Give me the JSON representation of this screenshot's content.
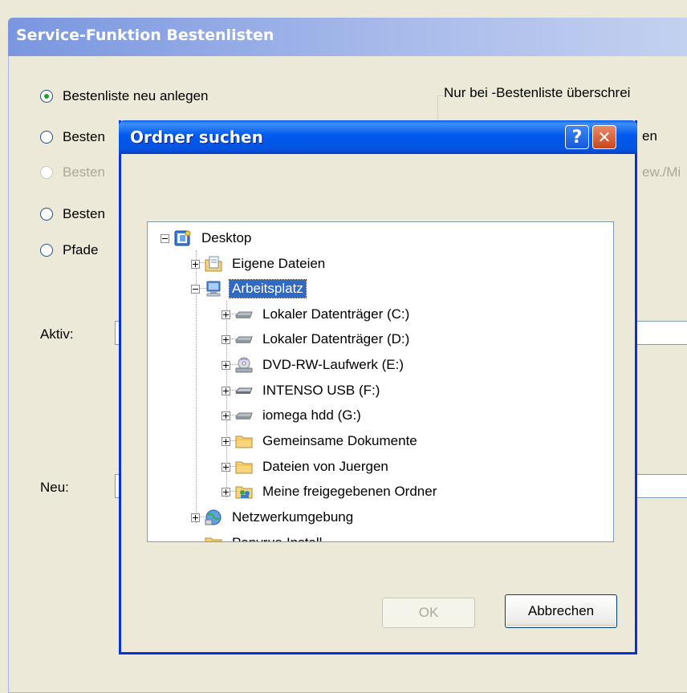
{
  "background_window": {
    "title": "Service-Funktion Bestenlisten",
    "radios": [
      {
        "label": "Bestenliste neu anlegen",
        "checked": true,
        "enabled": true
      },
      {
        "label": "Besten",
        "checked": false,
        "enabled": true
      },
      {
        "label": "Besten",
        "checked": false,
        "enabled": false
      },
      {
        "label": "Besten",
        "checked": false,
        "enabled": true
      },
      {
        "label": "Pfade",
        "checked": false,
        "enabled": true
      }
    ],
    "group_legend": "Nur bei -Bestenliste überschrei",
    "clipped_text_1": "en",
    "clipped_text_2": "ew./Mi",
    "aktiv_label": "Aktiv:",
    "neu_label": "Neu:"
  },
  "dialog": {
    "title": "Ordner suchen",
    "help_glyph": "?",
    "close_glyph": "✕",
    "tree": [
      {
        "label": "Desktop",
        "icon": "desktop-icon",
        "expander": "minus"
      },
      {
        "label": "Eigene Dateien",
        "icon": "my-documents-icon",
        "expander": "plus"
      },
      {
        "label": "Arbeitsplatz",
        "icon": "my-computer-icon",
        "expander": "minus",
        "selected": true
      },
      {
        "label": "Lokaler Datenträger (C:)",
        "icon": "hard-drive-icon",
        "expander": "plus"
      },
      {
        "label": "Lokaler Datenträger (D:)",
        "icon": "hard-drive-icon",
        "expander": "plus"
      },
      {
        "label": "DVD-RW-Laufwerk (E:)",
        "icon": "dvd-drive-icon",
        "expander": "plus"
      },
      {
        "label": "INTENSO USB (F:)",
        "icon": "usb-drive-icon",
        "expander": "plus"
      },
      {
        "label": "iomega hdd (G:)",
        "icon": "hard-drive-icon",
        "expander": "plus"
      },
      {
        "label": "Gemeinsame Dokumente",
        "icon": "folder-icon",
        "expander": "plus"
      },
      {
        "label": "Dateien von Juergen",
        "icon": "folder-icon",
        "expander": "plus"
      },
      {
        "label": "Meine freigegebenen Ordner",
        "icon": "shared-folder-icon",
        "expander": "plus"
      },
      {
        "label": "Netzwerkumgebung",
        "icon": "network-icon",
        "expander": "plus"
      },
      {
        "label": "Papyrus-Install",
        "icon": "folder-icon",
        "expander": "none"
      }
    ],
    "ok_label": "OK",
    "cancel_label": "Abbrechen"
  },
  "colors": {
    "dialog_titlebar": "#0058ee",
    "selection": "#316ac5",
    "window_face": "#ece9d8"
  }
}
